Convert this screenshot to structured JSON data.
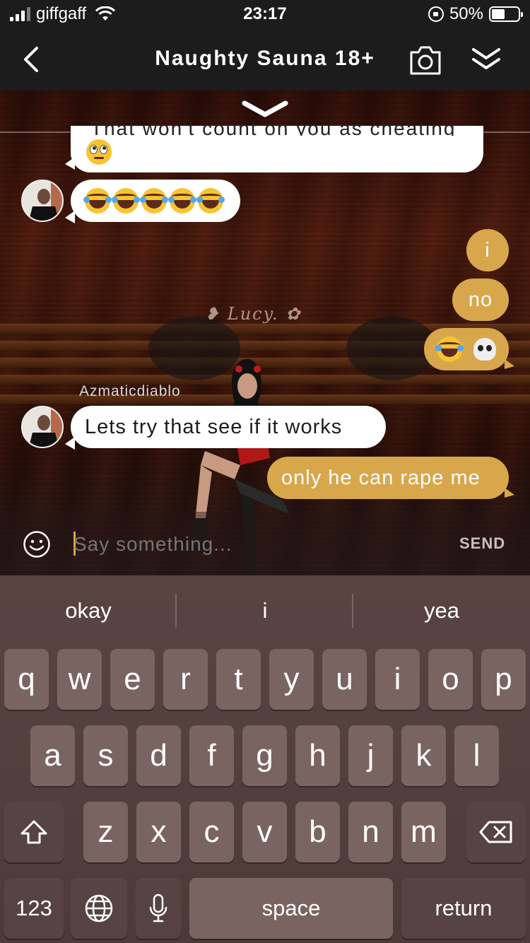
{
  "status_bar": {
    "carrier": "giffgaff",
    "time": "23:17",
    "battery_percent": "50%",
    "battery_level": 0.5
  },
  "nav": {
    "title": "Naughty Sauna 18+",
    "back_icon": "chevron-left-icon",
    "camera_icon": "camera-icon",
    "collapse_icon": "double-chevron-down-icon"
  },
  "chat": {
    "watermark": "Lucy.",
    "partial_message": "That won't count on you as cheating",
    "messages": [
      {
        "direction": "in",
        "emoji": [
          "face-with-rolling-eyes"
        ]
      },
      {
        "direction": "in",
        "emoji": [
          "face-with-tears-of-joy",
          "face-with-tears-of-joy",
          "face-with-tears-of-joy",
          "face-with-tears-of-joy",
          "face-with-tears-of-joy"
        ]
      },
      {
        "direction": "out",
        "text": "i"
      },
      {
        "direction": "out",
        "text": "no"
      },
      {
        "direction": "out",
        "emoji": [
          "face-with-tears-of-joy",
          "skull"
        ]
      },
      {
        "direction": "in",
        "sender": "Azmaticdiablo",
        "text": "Lets try that see if it works"
      },
      {
        "direction": "out",
        "text": "only he can rape me"
      }
    ]
  },
  "composer": {
    "placeholder": "Say something...",
    "send_label": "SEND",
    "emoji_icon": "smiley-icon"
  },
  "keyboard": {
    "suggestions": [
      "okay",
      "i",
      "yea"
    ],
    "row1": [
      "q",
      "w",
      "e",
      "r",
      "t",
      "y",
      "u",
      "i",
      "o",
      "p"
    ],
    "row2": [
      "a",
      "s",
      "d",
      "f",
      "g",
      "h",
      "j",
      "k",
      "l"
    ],
    "row3": [
      "z",
      "x",
      "c",
      "v",
      "b",
      "n",
      "m"
    ],
    "numbers_label": "123",
    "space_label": "space",
    "return_label": "return",
    "shift_icon": "shift-icon",
    "delete_icon": "backspace-icon",
    "globe_icon": "globe-icon",
    "mic_icon": "microphone-icon"
  }
}
